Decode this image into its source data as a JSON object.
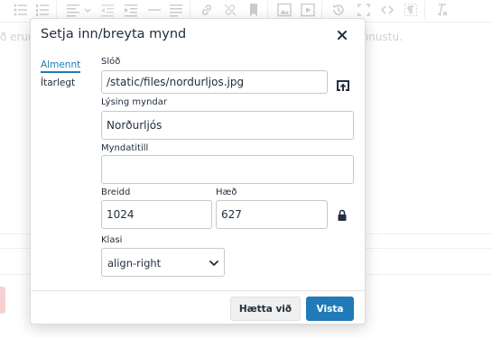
{
  "background": {
    "text_left": "ð erum",
    "text_right": "þjónustu."
  },
  "toolbar": {
    "icons": [
      "bullet-list-icon",
      "numbered-list-icon",
      "align-icon",
      "chevron-down-icon",
      "outdent-icon",
      "indent-icon",
      "horizontal-rule-icon",
      "justify-icon",
      "link-icon",
      "unlink-icon",
      "bookmark-icon",
      "image-icon",
      "media-icon",
      "history-icon",
      "fullscreen-icon",
      "code-icon",
      "paragraph-icon",
      "clear-format-icon"
    ]
  },
  "dialog": {
    "title": "Setja inn/breyta mynd",
    "tabs": [
      "Almennt",
      "Ítarlegt"
    ],
    "fields": {
      "source": {
        "label": "Slóð",
        "value": "/static/files/nordurljos.jpg"
      },
      "description": {
        "label": "Lýsing myndar",
        "value": "Norðurljós"
      },
      "title": {
        "label": "Myndatitill",
        "value": ""
      },
      "width": {
        "label": "Breidd",
        "value": "1024"
      },
      "height": {
        "label": "Hæð",
        "value": "627"
      },
      "class": {
        "label": "Klasi",
        "value": "align-right"
      }
    },
    "buttons": {
      "cancel": "Hætta við",
      "save": "Vista"
    }
  },
  "colors": {
    "accent": "#207ab7",
    "text": "#222f3e",
    "border": "#c8c8c8"
  }
}
